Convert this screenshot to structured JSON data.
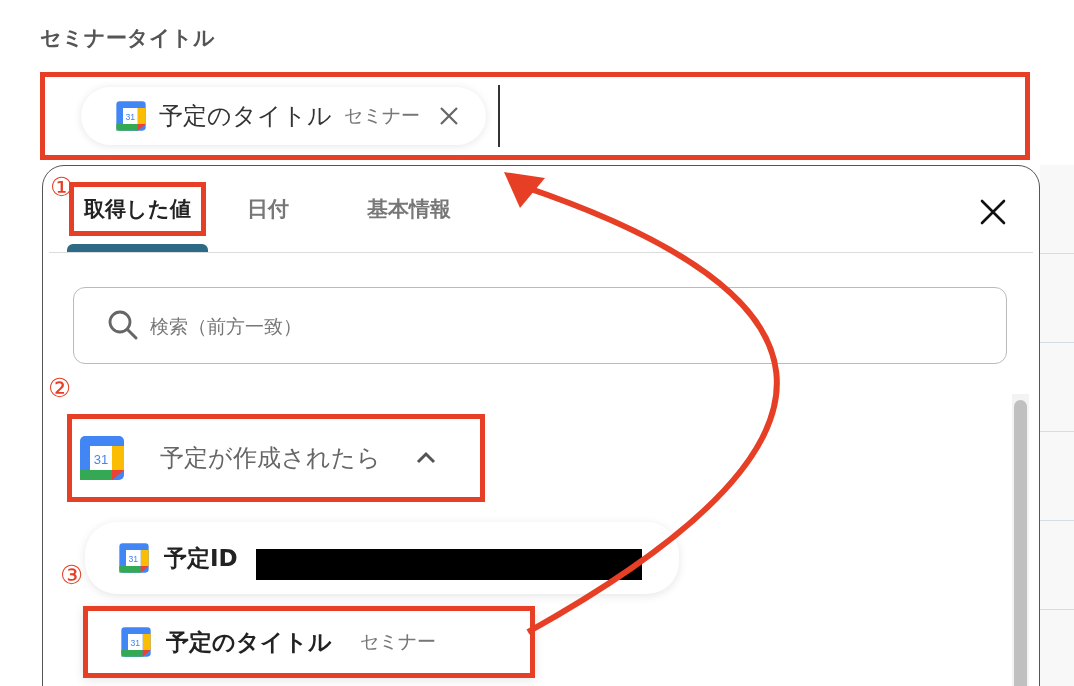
{
  "field_label": "セミナータイトル",
  "input": {
    "highlighted": true,
    "chips": [
      {
        "icon_label": "31",
        "title": "予定のタイトル",
        "value": "セミナー"
      }
    ]
  },
  "panel": {
    "tabs": [
      {
        "label": "取得した値",
        "selected": true,
        "highlighted": true
      },
      {
        "label": "日付",
        "selected": false,
        "highlighted": false
      },
      {
        "label": "基本情報",
        "selected": false,
        "highlighted": false
      }
    ],
    "search": {
      "placeholder": "検索（前方一致）"
    },
    "group": {
      "icon_label": "31",
      "title": "予定が作成されたら",
      "expanded": true,
      "highlighted": true,
      "items": [
        {
          "kind": "redacted",
          "icon_label": "31",
          "label": "予定ID",
          "highlighted": false
        },
        {
          "kind": "text",
          "icon_label": "31",
          "label": "予定のタイトル",
          "value": "セミナー",
          "highlighted": true
        }
      ]
    }
  },
  "annotations": [
    "①",
    "②",
    "③"
  ]
}
